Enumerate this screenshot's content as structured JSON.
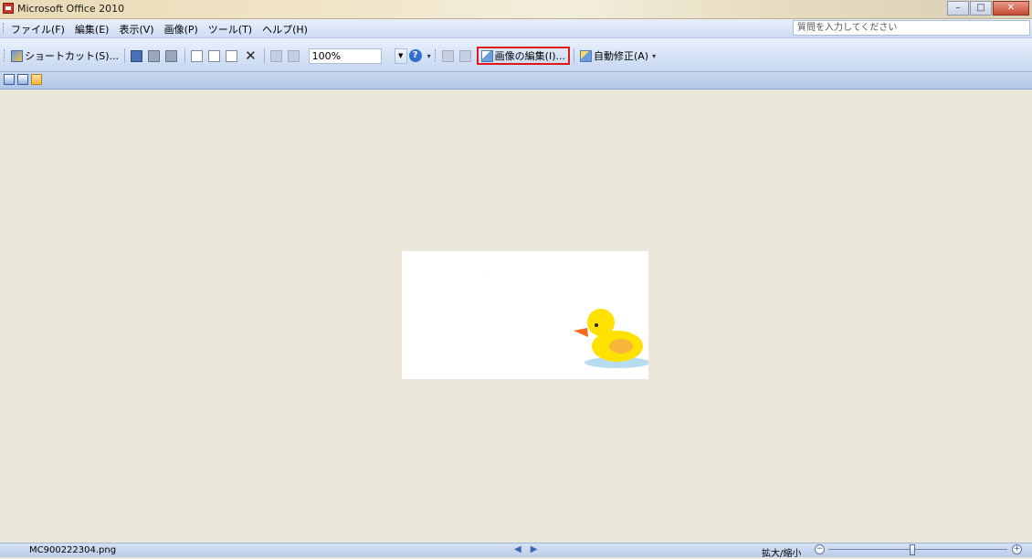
{
  "window": {
    "title": "Microsoft Office 2010"
  },
  "menu": {
    "items": [
      "ファイル(F)",
      "編集(E)",
      "表示(V)",
      "画像(P)",
      "ツール(T)",
      "ヘルプ(H)"
    ],
    "help_placeholder": "質問を入力してください"
  },
  "toolbar": {
    "shortcut_label": "ショートカット(S)...",
    "zoom_value": "100%",
    "edit_picture_label": "画像の編集(I)...",
    "auto_correct_label": "自動修正(A)",
    "icons": [
      "save-icon",
      "print-icon",
      "print-preview-icon",
      "cut-icon",
      "copy-icon",
      "paste-icon",
      "delete-icon",
      "undo-icon",
      "redo-icon",
      "help-icon",
      "rotate-left-icon",
      "rotate-right-icon",
      "edit-picture-icon",
      "auto-correct-icon"
    ],
    "highlight_color": "#e01818"
  },
  "view": {
    "buttons": [
      "thumbnail-view",
      "filmstrip-view",
      "single-picture-view"
    ],
    "active": "single-picture-view"
  },
  "status": {
    "filename": "MC900222304.png",
    "zoom_label": "拡大/縮小",
    "zoom_level": 0.47
  }
}
